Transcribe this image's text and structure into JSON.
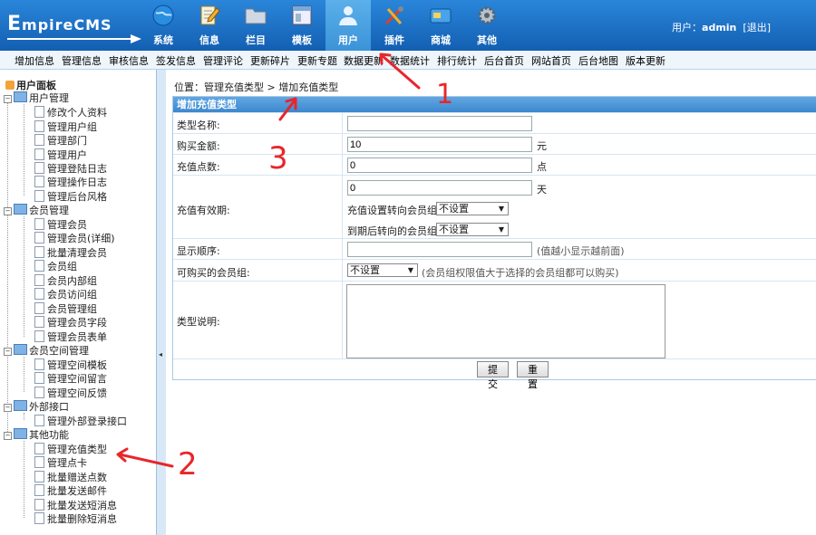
{
  "logo": {
    "text_big": "E",
    "text_rest": "mpireCMS"
  },
  "nav": [
    {
      "label": "系统",
      "icon": "globe-icon"
    },
    {
      "label": "信息",
      "icon": "document-pencil-icon"
    },
    {
      "label": "栏目",
      "icon": "folder-icon"
    },
    {
      "label": "模板",
      "icon": "template-icon"
    },
    {
      "label": "用户",
      "icon": "user-icon"
    },
    {
      "label": "插件",
      "icon": "tools-icon"
    },
    {
      "label": "商城",
      "icon": "card-icon"
    },
    {
      "label": "其他",
      "icon": "gear-icon"
    }
  ],
  "user": {
    "prefix": "用户：",
    "name": "admin",
    "logout": "[退出]"
  },
  "submenu": [
    "增加信息",
    "管理信息",
    "审核信息",
    "签发信息",
    "管理评论",
    "更新碎片",
    "更新专题",
    "数据更新",
    "数据统计",
    "排行统计",
    "后台首页",
    "网站首页",
    "后台地图",
    "版本更新"
  ],
  "sidebar": {
    "title": "用户面板",
    "groups": [
      {
        "label": "用户管理",
        "items": [
          "修改个人资料",
          "管理用户组",
          "管理部门",
          "管理用户",
          "管理登陆日志",
          "管理操作日志",
          "管理后台风格"
        ]
      },
      {
        "label": "会员管理",
        "items": [
          "管理会员",
          "管理会员(详细)",
          "批量清理会员",
          "会员组",
          "会员内部组",
          "会员访问组",
          "会员管理组",
          "管理会员字段",
          "管理会员表单"
        ]
      },
      {
        "label": "会员空间管理",
        "items": [
          "管理空间模板",
          "管理空间留言",
          "管理空间反馈"
        ]
      },
      {
        "label": "外部接口",
        "items": [
          "管理外部登录接口"
        ]
      },
      {
        "label": "其他功能",
        "items": [
          "管理充值类型",
          "管理点卡",
          "批量赠送点数",
          "批量发送邮件",
          "批量发送短消息",
          "批量删除短消息"
        ]
      }
    ],
    "collapse_glyph": "◂"
  },
  "breadcrumb": {
    "prefix": "位置：",
    "parent": "管理充值类型",
    "sep": " > ",
    "current": "增加充值类型"
  },
  "form": {
    "title": "增加充值类型",
    "type_name_label": "类型名称:",
    "type_name_value": "",
    "amount_label": "购买金额:",
    "amount_value": "10",
    "amount_unit": "元",
    "points_label": "充值点数:",
    "points_value": "0",
    "points_unit": "点",
    "validity_label": "充值有效期:",
    "validity_value": "0",
    "validity_unit": "天",
    "group_after_label": "充值设置转向会员组:",
    "group_after_value": "不设置",
    "expire_group_label": "到期后转向的会员组:",
    "expire_group_value": "不设置",
    "order_label": "显示顺序:",
    "order_value": "",
    "order_note": "(值越小显示越前面)",
    "buy_group_label": "可购买的会员组:",
    "buy_group_value": "不设置",
    "buy_group_note": "(会员组权限值大于选择的会员组都可以购买)",
    "desc_label": "类型说明:",
    "desc_value": "",
    "submit": "提交",
    "reset": "重置"
  },
  "annotations": {
    "mark1": "1",
    "mark2": "2",
    "mark3": "3",
    "color": "#e8262a"
  }
}
